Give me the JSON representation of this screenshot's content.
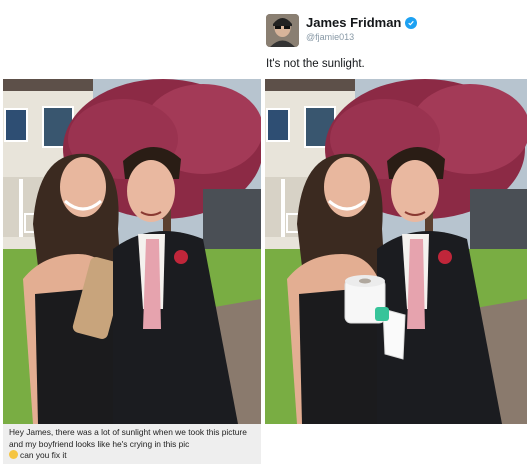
{
  "tweet": {
    "author_name": "James Fridman",
    "author_handle": "@fjamie013",
    "text": "It's not the sunlight.",
    "verified_color": "#1da1f2"
  },
  "left_photo": {
    "held_object": "clutch purse (held by girl)"
  },
  "right_photo": {
    "held_object": "toilet paper roll (held by boy)"
  },
  "request_caption": {
    "text": "Hey James, there was a lot of sunlight when we took this picture and my boyfriend looks like he's crying in this pic",
    "text_end": "can you fix it",
    "emoji": "crying-laughing-emoji"
  }
}
